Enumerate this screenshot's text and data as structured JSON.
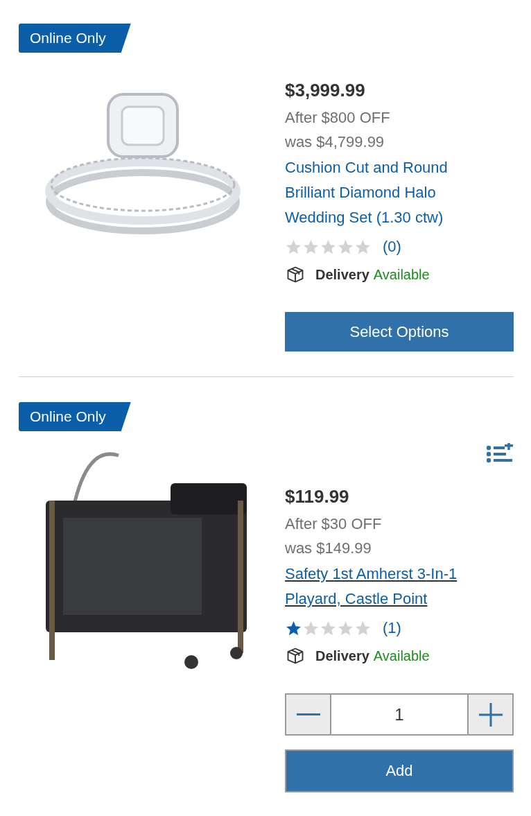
{
  "products": [
    {
      "kind": "options",
      "badge": "Online Only",
      "list_icon": false,
      "price": "$3,999.99",
      "discount": "After $800 OFF",
      "was_price": "was $4,799.99",
      "title": "Cushion Cut and Round Brilliant Diamond Halo Wedding Set (1.30 ctw)",
      "underlined": false,
      "stars": 0,
      "review_count": "(0)",
      "delivery_label": "Delivery",
      "delivery_status": "Available",
      "button": "Select Options"
    },
    {
      "kind": "quantity",
      "badge": "Online Only",
      "list_icon": true,
      "price": "$119.99",
      "discount": "After $30 OFF",
      "was_price": "was $149.99",
      "title": "Safety 1st Amherst 3-In-1 Playard, Castle Point",
      "underlined": true,
      "stars": 1,
      "review_count": "(1)",
      "delivery_label": "Delivery",
      "delivery_status": "Available",
      "quantity": "1",
      "button": "Add"
    }
  ]
}
